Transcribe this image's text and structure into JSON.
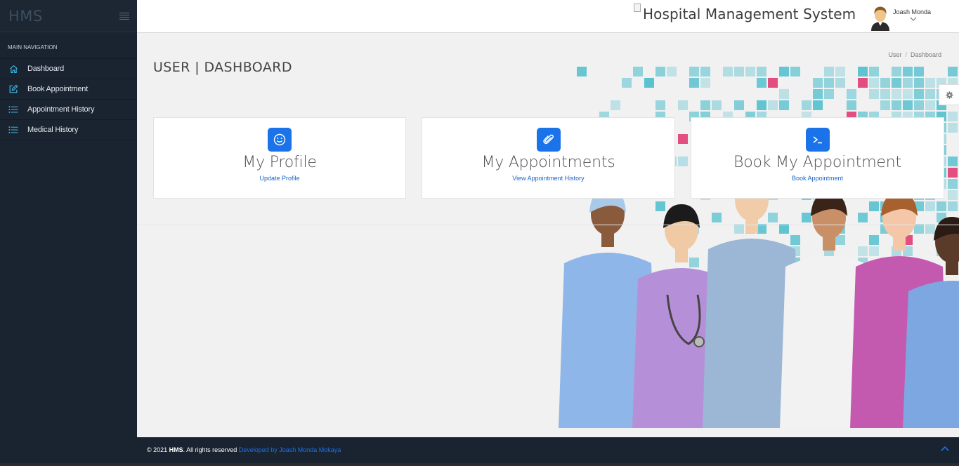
{
  "sidebar": {
    "brand": "HMS",
    "nav_title": "MAIN NAVIGATION",
    "items": [
      {
        "label": "Dashboard",
        "icon": "home-icon"
      },
      {
        "label": "Book Appointment",
        "icon": "pencil-square-icon"
      },
      {
        "label": "Appointment History",
        "icon": "list-icon"
      },
      {
        "label": "Medical History",
        "icon": "list-icon"
      }
    ]
  },
  "header": {
    "title": "Hospital Management System",
    "username": "Joash Monda"
  },
  "page": {
    "title": "USER | DASHBOARD",
    "breadcrumb": [
      "User",
      "Dashboard"
    ]
  },
  "cards": [
    {
      "title": "My Profile",
      "link": "Update Profile",
      "icon": "smile-icon"
    },
    {
      "title": "My Appointments",
      "link": "View Appointment History",
      "icon": "paperclip-icon"
    },
    {
      "title": "Book My Appointment",
      "link": "Book Appointment",
      "icon": "terminal-icon"
    }
  ],
  "footer": {
    "prefix": "© 2021",
    "brand": "HMS",
    "rights": ". All rights reserved",
    "developer": "Developed by Joash Monda Mokaya"
  },
  "colors": {
    "sidebar_bg": "#1a2330",
    "accent": "#1a73e8",
    "nav_icon": "#3fb8e6",
    "tile_teal": "#3fb9c9",
    "tile_pink": "#e2306c"
  }
}
